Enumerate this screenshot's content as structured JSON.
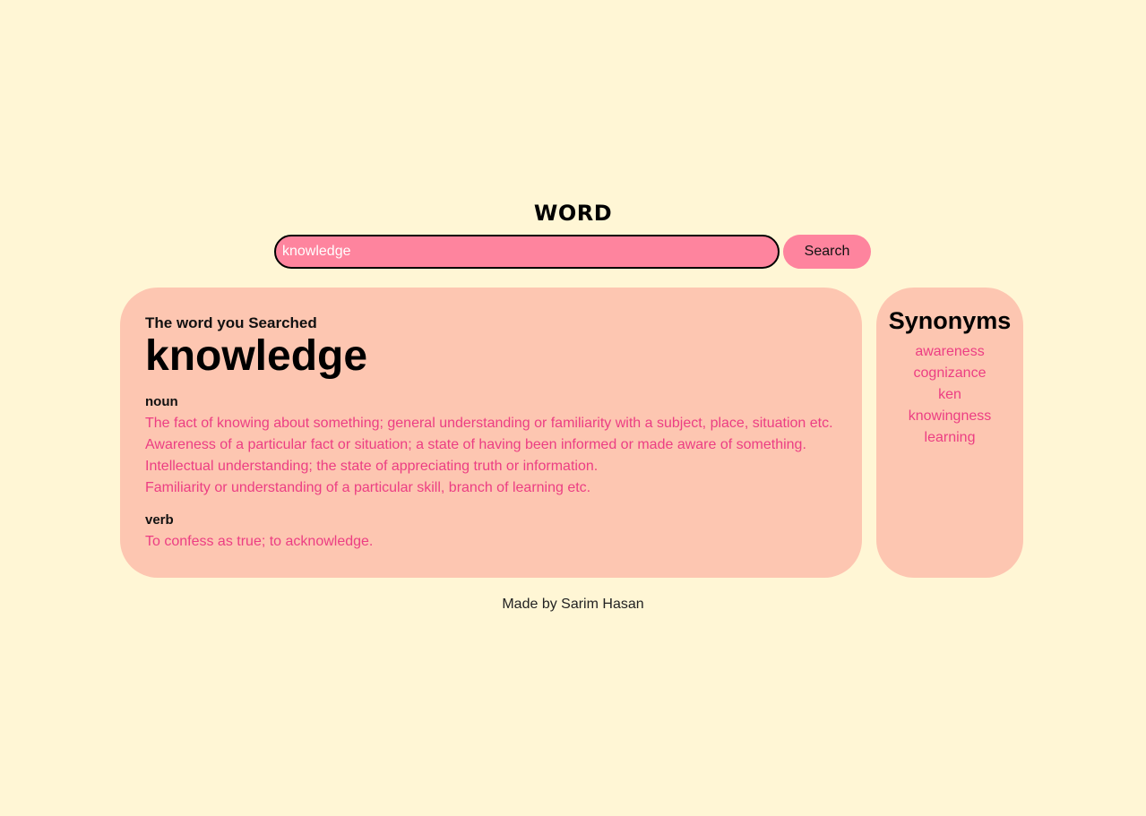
{
  "app_title": "WORD",
  "search": {
    "value": "knowledge",
    "button_label": "Search"
  },
  "result": {
    "label": "The word you Searched",
    "word": "knowledge",
    "parts_of_speech": [
      {
        "pos": "noun",
        "meanings": [
          "The fact of knowing about something; general understanding or familiarity with a subject, place, situation etc.",
          "Awareness of a particular fact or situation; a state of having been informed or made aware of something.",
          "Intellectual understanding; the state of appreciating truth or information.",
          "Familiarity or understanding of a particular skill, branch of learning etc."
        ]
      },
      {
        "pos": "verb",
        "meanings": [
          "To confess as true; to acknowledge."
        ]
      }
    ]
  },
  "synonyms": {
    "title": "Synonyms",
    "items": [
      "awareness",
      "cognizance",
      "ken",
      "knowingness",
      "learning"
    ]
  },
  "footer": "Made by Sarim Hasan",
  "colors": {
    "background": "#fff6d5",
    "card": "#fdc6b1",
    "accent": "#fe849e",
    "text_pink": "#ec3e83"
  }
}
